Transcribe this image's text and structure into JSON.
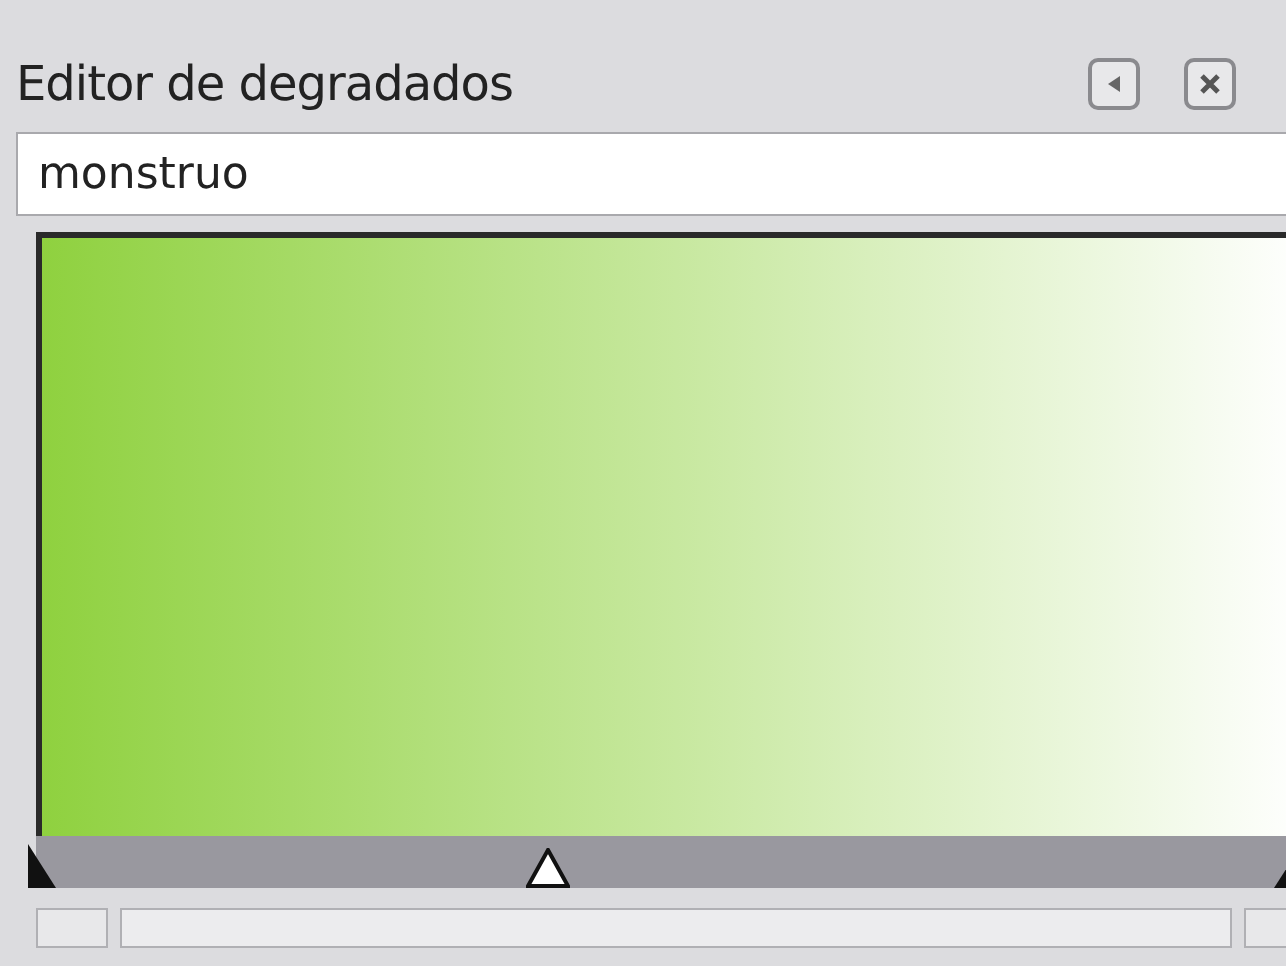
{
  "panel": {
    "title": "Editor de degradados"
  },
  "name_field": {
    "value": "monstruo"
  },
  "gradient": {
    "midpoint": {
      "level": 0.4
    }
  }
}
